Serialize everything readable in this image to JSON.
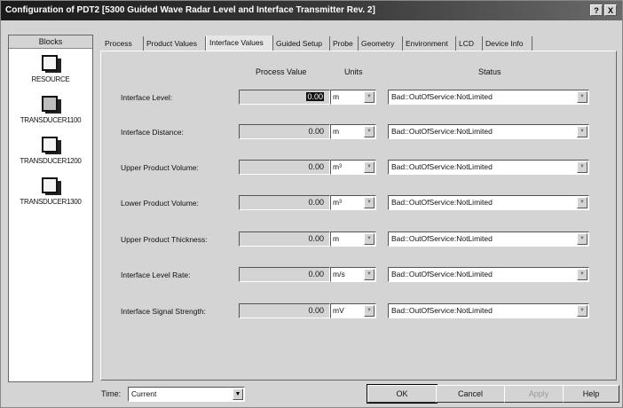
{
  "window": {
    "title": "Configuration of PDT2 [5300 Guided Wave Radar Level and Interface Transmitter Rev. 2]",
    "help_glyph": "?",
    "close_glyph": "X"
  },
  "blocks": {
    "header": "Blocks",
    "items": [
      {
        "label": "RESOURCE",
        "icon": "block-icon",
        "selected": false
      },
      {
        "label": "TRANSDUCER1100",
        "icon": "block-icon",
        "selected": true
      },
      {
        "label": "TRANSDUCER1200",
        "icon": "block-icon",
        "selected": false
      },
      {
        "label": "TRANSDUCER1300",
        "icon": "block-icon",
        "selected": false
      }
    ]
  },
  "tabs": [
    {
      "label": "Process"
    },
    {
      "label": "Product Values"
    },
    {
      "label": "Interface Values",
      "active": true
    },
    {
      "label": "Guided Setup"
    },
    {
      "label": "Probe"
    },
    {
      "label": "Geometry"
    },
    {
      "label": "Environment"
    },
    {
      "label": "LCD"
    },
    {
      "label": "Device Info"
    }
  ],
  "columns": {
    "process_value": "Process Value",
    "units": "Units",
    "status": "Status"
  },
  "rows": [
    {
      "label": "Interface Level:",
      "value": "0.00",
      "unit": "m",
      "status": "Bad::OutOfService:NotLimited"
    },
    {
      "label": "Interface Distance:",
      "value": "0.00",
      "unit": "m",
      "status": "Bad::OutOfService:NotLimited"
    },
    {
      "label": "Upper Product Volume:",
      "value": "0.00",
      "unit": "m³",
      "status": "Bad::OutOfService:NotLimited"
    },
    {
      "label": "Lower Product Volume:",
      "value": "0.00",
      "unit": "m³",
      "status": "Bad::OutOfService:NotLimited"
    },
    {
      "label": "Upper Product Thickness:",
      "value": "0.00",
      "unit": "m",
      "status": "Bad::OutOfService:NotLimited"
    },
    {
      "label": "Interface Level Rate:",
      "value": "0.00",
      "unit": "m/s",
      "status": "Bad::OutOfService:NotLimited"
    },
    {
      "label": "Interface Signal Strength:",
      "value": "0.00",
      "unit": "mV",
      "status": "Bad::OutOfService:NotLimited"
    }
  ],
  "footer": {
    "time_label": "Time:",
    "time_value": "Current",
    "ok": "OK",
    "cancel": "Cancel",
    "apply": "Apply",
    "help": "Help"
  }
}
